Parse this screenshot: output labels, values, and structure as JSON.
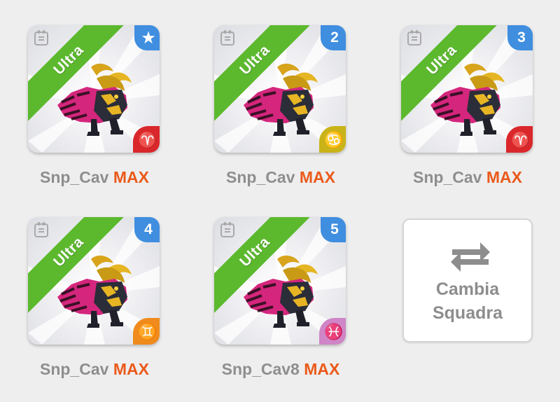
{
  "team": [
    {
      "ribbon": "Ultra",
      "badge": "★",
      "badge_color": "#3f8ee0",
      "zodiac_icon": "aries-icon",
      "zodiac_glyph": "♈",
      "zodiac_color": "#d9272b",
      "name": "Snp_Cav",
      "level": "MAX"
    },
    {
      "ribbon": "Ultra",
      "badge": "2",
      "badge_color": "#3f8ee0",
      "zodiac_icon": "cancer-icon",
      "zodiac_glyph": "♋",
      "zodiac_color": "#c9b318",
      "name": "Snp_Cav",
      "level": "MAX"
    },
    {
      "ribbon": "Ultra",
      "badge": "3",
      "badge_color": "#3f8ee0",
      "zodiac_icon": "aries-icon",
      "zodiac_glyph": "♈",
      "zodiac_color": "#d9272b",
      "name": "Snp_Cav",
      "level": "MAX"
    },
    {
      "ribbon": "Ultra",
      "badge": "4",
      "badge_color": "#3f8ee0",
      "zodiac_icon": "gemini-icon",
      "zodiac_glyph": "♊",
      "zodiac_color": "#ef8a1c",
      "name": "Snp_Cav",
      "level": "MAX"
    },
    {
      "ribbon": "Ultra",
      "badge": "5",
      "badge_color": "#3f8ee0",
      "zodiac_icon": "pisces-icon",
      "zodiac_glyph": "♓",
      "zodiac_color": "#cf85c6",
      "name": "Snp_Cav8",
      "level": "MAX"
    }
  ],
  "switch_team": {
    "line1": "Cambia",
    "line2": "Squadra",
    "icon": "swap-arrows-icon"
  },
  "colors": {
    "ribbon": "#5cb92e",
    "max": "#ea5a1b",
    "name": "#8e8e8e",
    "badge": "#3f8ee0"
  }
}
